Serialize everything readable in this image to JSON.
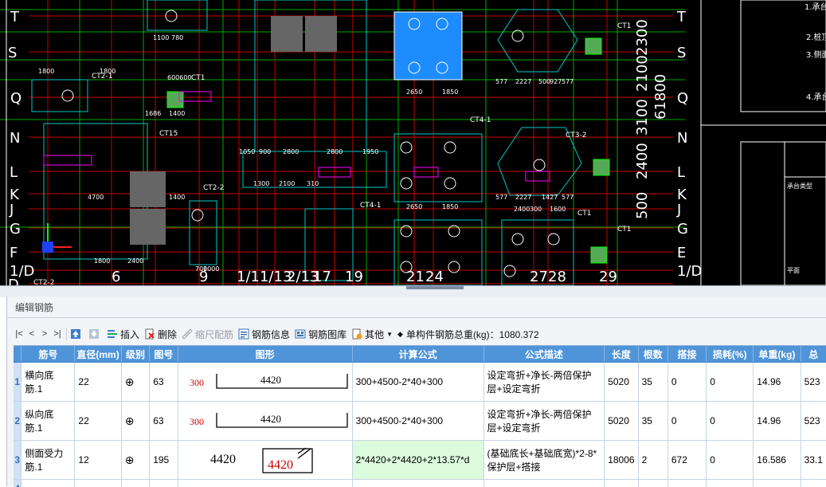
{
  "cad": {
    "grid_left": [
      "T",
      "S",
      "Q",
      "N",
      "L",
      "K",
      "J",
      "G",
      "F",
      "1/D",
      "D"
    ],
    "grid_right": [
      "T",
      "S",
      "Q",
      "N",
      "L",
      "K",
      "J",
      "G",
      "E",
      "1/D"
    ],
    "grid_bottom": [
      "6",
      "9",
      "1/11/13",
      "2/13",
      "17",
      "19",
      "21",
      "24",
      "27",
      "28",
      "29"
    ],
    "labels": [
      "CT2-1",
      "CT1",
      "CT15",
      "CT2-2",
      "CT4-1",
      "CT3-2",
      "CT4-1",
      "CT1",
      "CT1",
      "CT1",
      "CT2-2"
    ],
    "dims_top": [
      "1800",
      "600600",
      "1100",
      "780",
      "1800",
      "2650",
      "1850",
      "577",
      "2227",
      "500",
      "927",
      "577"
    ],
    "dims_mid": [
      "1686",
      "1400",
      "1050",
      "900",
      "2800",
      "2800",
      "1950",
      "2650",
      "1850",
      "577",
      "2227",
      "1427",
      "577"
    ],
    "dims_low": [
      "4700",
      "1400",
      "1300",
      "2100",
      "310",
      "2400",
      "300",
      "1600",
      "1800",
      "2400",
      "700",
      "1000"
    ],
    "right_vert": [
      "2300",
      "2100",
      "3100",
      "2400",
      "500",
      "61800"
    ],
    "legend_notes": [
      "1.承台",
      "2.桩顶",
      "3.侧面",
      "4.承台"
    ],
    "table_labels": [
      "承台类型",
      "平面"
    ]
  },
  "panel": {
    "title": "编辑钢筋",
    "toolbar": {
      "nav": [
        "|<",
        "<",
        ">",
        ">|"
      ],
      "insert": "插入",
      "delete": "删除",
      "scale_config": "缩尺配筋",
      "rebar_info": "钢筋信息",
      "rebar_lib": "钢筋图库",
      "other": "其他",
      "total_weight_label": "单构件钢筋总重(kg)：1080.372"
    },
    "columns": [
      "筋号",
      "直径(mm)",
      "级别",
      "图号",
      "图形",
      "计算公式",
      "公式描述",
      "长度",
      "根数",
      "搭接",
      "损耗(%)",
      "单重(kg)",
      "总"
    ],
    "rows": [
      {
        "num": "1",
        "name": "横向底筋.1",
        "dia": "22",
        "grade": "⊕",
        "fig": "63",
        "s_left": "300",
        "s_main": "4420",
        "s_right": "300",
        "formula": "300+4500-2*40+300",
        "desc": "设定弯折+净长-两倍保护层+设定弯折",
        "len": "5020",
        "count": "35",
        "lap": "0",
        "loss": "0",
        "unit_w": "14.96",
        "total": "523"
      },
      {
        "num": "2",
        "name": "纵向底筋.1",
        "dia": "22",
        "grade": "⊕",
        "fig": "63",
        "s_left": "300",
        "s_main": "4420",
        "s_right": "300",
        "formula": "300+4500-2*40+300",
        "desc": "设定弯折+净长-两倍保护层+设定弯折",
        "len": "5020",
        "count": "35",
        "lap": "0",
        "loss": "0",
        "unit_w": "14.96",
        "total": "523"
      },
      {
        "num": "3",
        "name": "侧面受力筋.1",
        "dia": "12",
        "grade": "⊕",
        "fig": "195",
        "s_left": "4420",
        "s_main": "4420",
        "formula": "2*4420+2*4420+2*13.57*d",
        "desc": "(基础底长+基础底宽)*2-8*保护层+搭接",
        "len": "18006",
        "count": "2",
        "lap": "672",
        "loss": "0",
        "unit_w": "16.586",
        "total": "33.1"
      },
      {
        "num": "4"
      }
    ]
  }
}
